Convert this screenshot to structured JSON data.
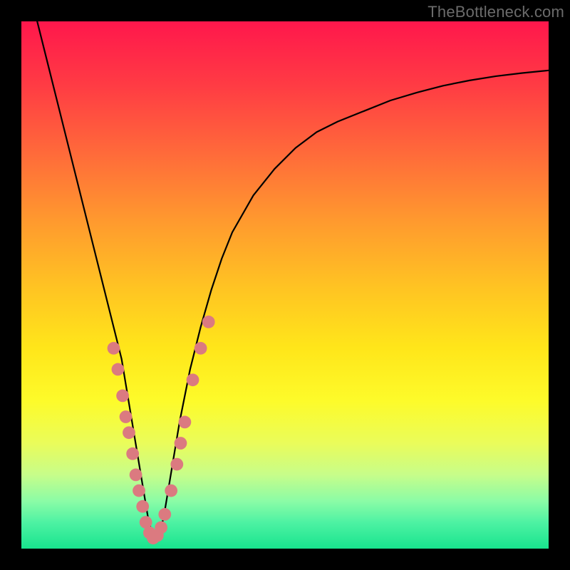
{
  "watermark": "TheBottleneck.com",
  "chart_data": {
    "type": "line",
    "title": "",
    "xlabel": "",
    "ylabel": "",
    "xlim": [
      0,
      100
    ],
    "ylim": [
      0,
      100
    ],
    "grid": false,
    "legend": false,
    "series": [
      {
        "name": "curve",
        "color": "#000000",
        "x": [
          3,
          5,
          7,
          9,
          11,
          13,
          15,
          17,
          19,
          20,
          21,
          22,
          23,
          24,
          25,
          26,
          27,
          28,
          30,
          32,
          34,
          36,
          38,
          40,
          44,
          48,
          52,
          56,
          60,
          65,
          70,
          75,
          80,
          85,
          90,
          95,
          100
        ],
        "values": [
          100,
          92,
          84,
          76,
          68,
          60,
          52,
          44,
          36,
          30,
          24,
          18,
          12,
          6,
          2,
          2,
          6,
          12,
          24,
          34,
          42,
          49,
          55,
          60,
          67,
          72,
          76,
          79,
          81,
          83,
          85,
          86.5,
          87.8,
          88.8,
          89.6,
          90.2,
          90.7
        ]
      }
    ],
    "points": {
      "name": "scatter",
      "color": "#db7a80",
      "radius_percent": 1.2,
      "x": [
        17.5,
        18.3,
        19.2,
        19.8,
        20.4,
        21.1,
        21.7,
        22.3,
        23.0,
        23.6,
        24.3,
        25.0,
        25.8,
        26.5,
        27.2,
        28.4,
        29.5,
        30.2,
        31.0,
        32.5,
        34.0,
        35.5
      ],
      "values": [
        38.0,
        34.0,
        29.0,
        25.0,
        22.0,
        18.0,
        14.0,
        11.0,
        8.0,
        5.0,
        3.0,
        2.0,
        2.5,
        4.0,
        6.5,
        11.0,
        16.0,
        20.0,
        24.0,
        32.0,
        38.0,
        43.0
      ]
    }
  }
}
